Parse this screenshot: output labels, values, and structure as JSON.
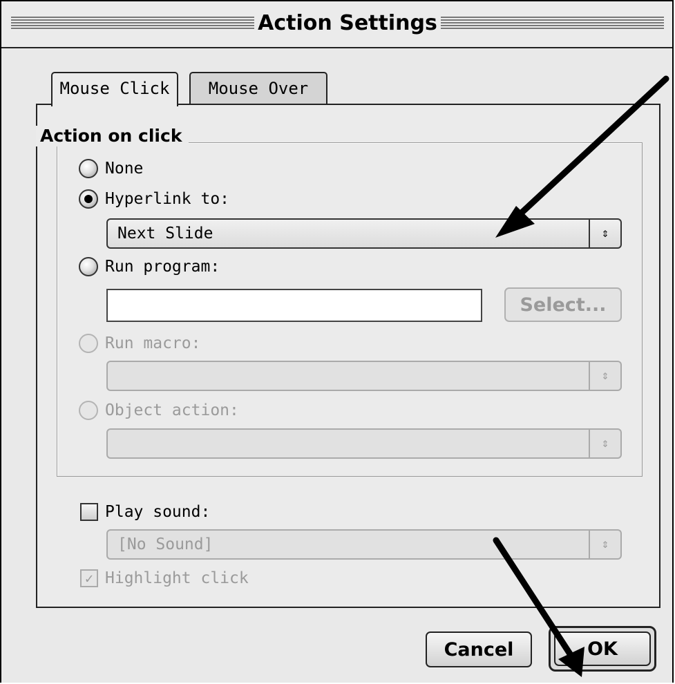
{
  "window": {
    "title": "Action Settings"
  },
  "tabs": [
    {
      "label": "Mouse Click",
      "active": true
    },
    {
      "label": "Mouse Over",
      "active": false
    }
  ],
  "group": {
    "title": "Action on click"
  },
  "options": {
    "none": {
      "label": "None",
      "checked": false,
      "enabled": true
    },
    "hyperlink": {
      "label": "Hyperlink to:",
      "checked": true,
      "enabled": true,
      "value": "Next Slide"
    },
    "run_program": {
      "label": "Run program:",
      "checked": false,
      "enabled": true,
      "value": "",
      "select_label": "Select..."
    },
    "run_macro": {
      "label": "Run macro:",
      "checked": false,
      "enabled": false,
      "value": ""
    },
    "object_action": {
      "label": "Object action:",
      "checked": false,
      "enabled": false,
      "value": ""
    }
  },
  "sound": {
    "label": "Play sound:",
    "checked": false,
    "value": "[No Sound]"
  },
  "highlight": {
    "label": "Highlight click",
    "checked": true,
    "enabled": false
  },
  "buttons": {
    "cancel": "Cancel",
    "ok": "OK"
  },
  "icons": {
    "popup_arrows": "updown-arrows-icon",
    "checkmark": "checkmark-icon"
  },
  "symbols": {
    "updown": "⇕",
    "check": "✓"
  }
}
